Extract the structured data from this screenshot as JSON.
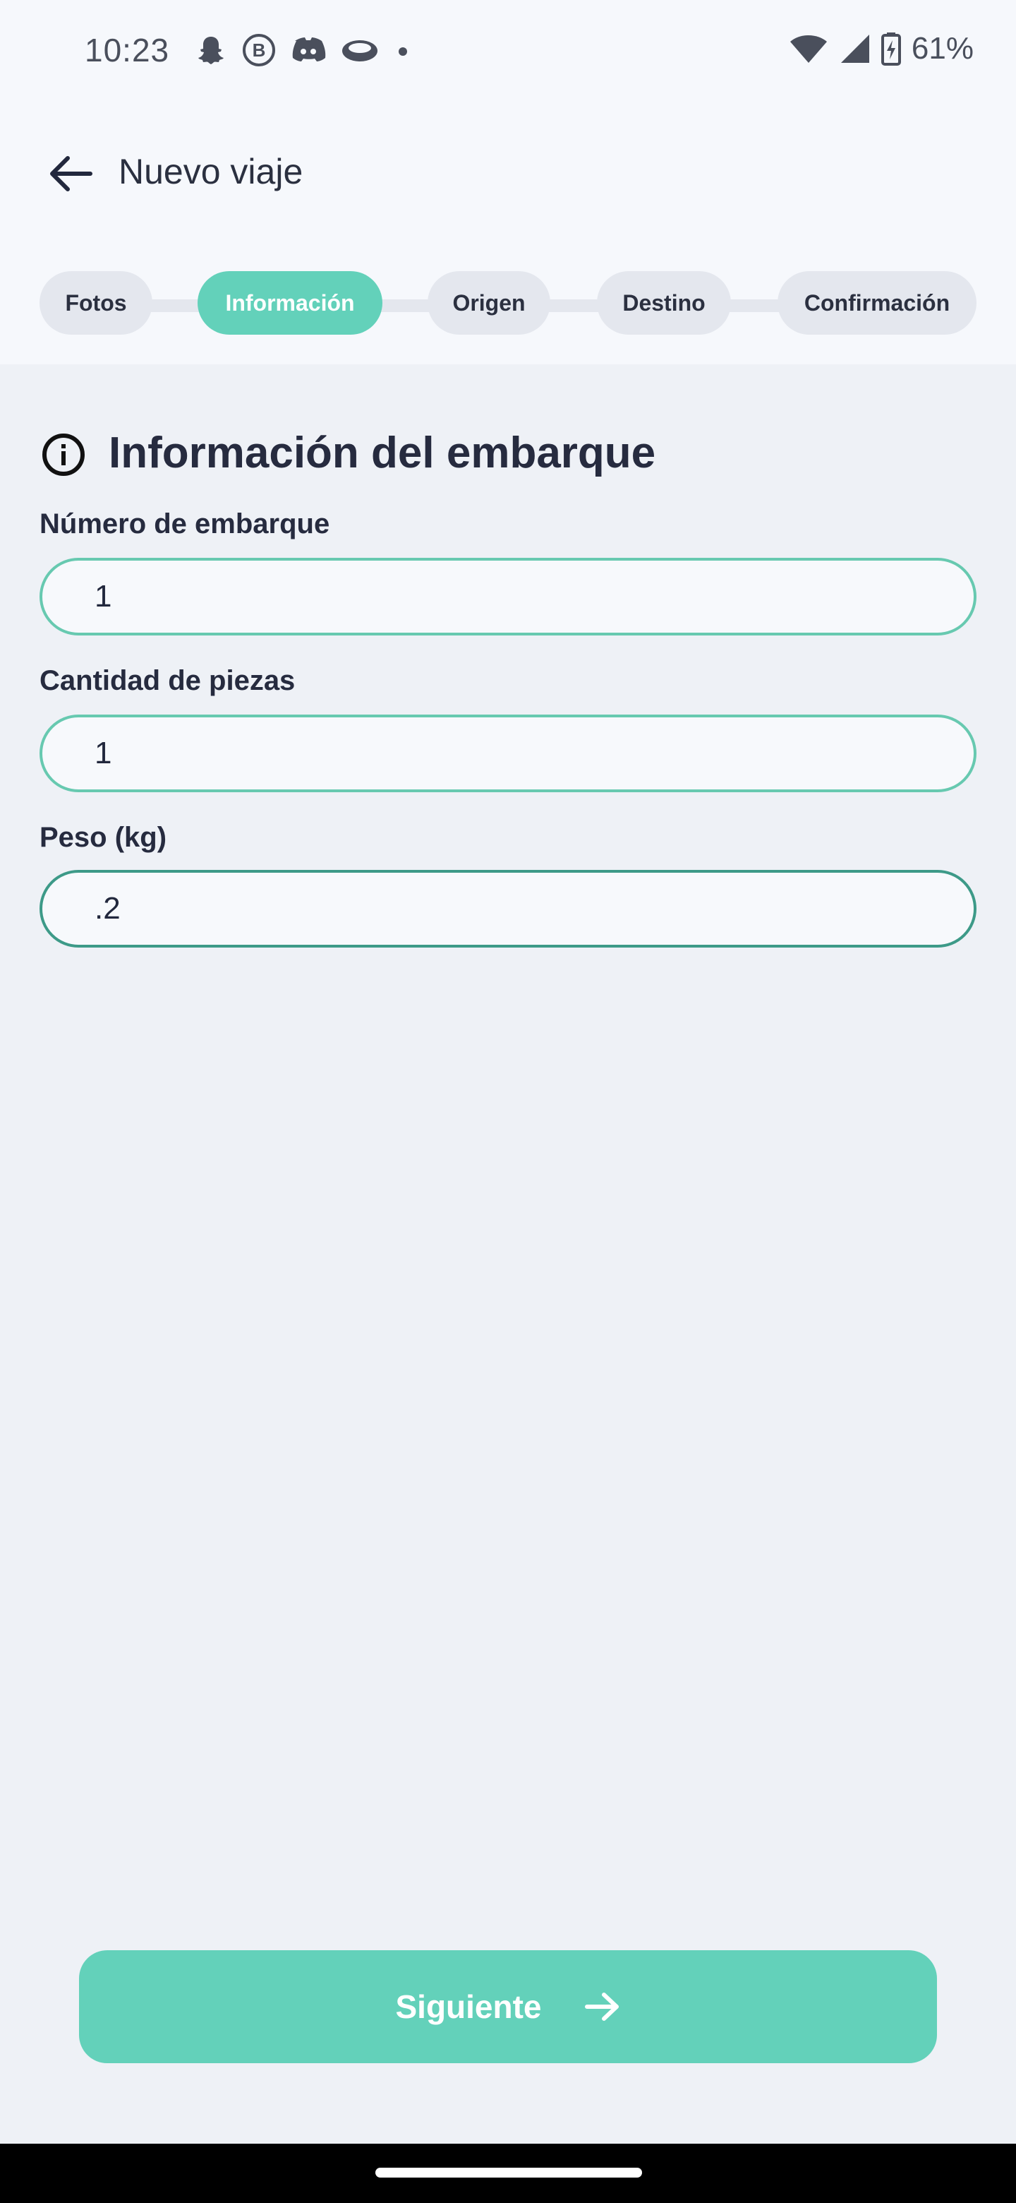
{
  "status_bar": {
    "time": "10:23",
    "battery": "61%",
    "notification_icons": [
      "snapchat-icon",
      "b-circle-icon",
      "discord-icon",
      "game-icon",
      "dot-icon"
    ],
    "system_icons": [
      "wifi-icon",
      "signal-icon",
      "battery-charging-icon"
    ]
  },
  "header": {
    "title": "Nuevo viaje",
    "back_icon": "arrow-left-icon"
  },
  "stepper": {
    "steps": [
      {
        "label": "Fotos",
        "active": false
      },
      {
        "label": "Información",
        "active": true
      },
      {
        "label": "Origen",
        "active": false
      },
      {
        "label": "Destino",
        "active": false
      },
      {
        "label": "Confirmación",
        "active": false
      }
    ]
  },
  "section": {
    "icon": "info-circle-icon",
    "title": "Información del embarque"
  },
  "fields": [
    {
      "label": "Número de embarque",
      "value": "1"
    },
    {
      "label": "Cantidad de piezas",
      "value": "1"
    },
    {
      "label": "Peso (kg)",
      "value": ".2"
    }
  ],
  "actions": {
    "next_label": "Siguiente",
    "next_icon": "arrow-right-icon"
  },
  "colors": {
    "accent": "#63d1ba",
    "input_border": "#67c9b0",
    "background": "#eef1f6",
    "header_background": "#f6f8fc",
    "text": "#22283d"
  }
}
